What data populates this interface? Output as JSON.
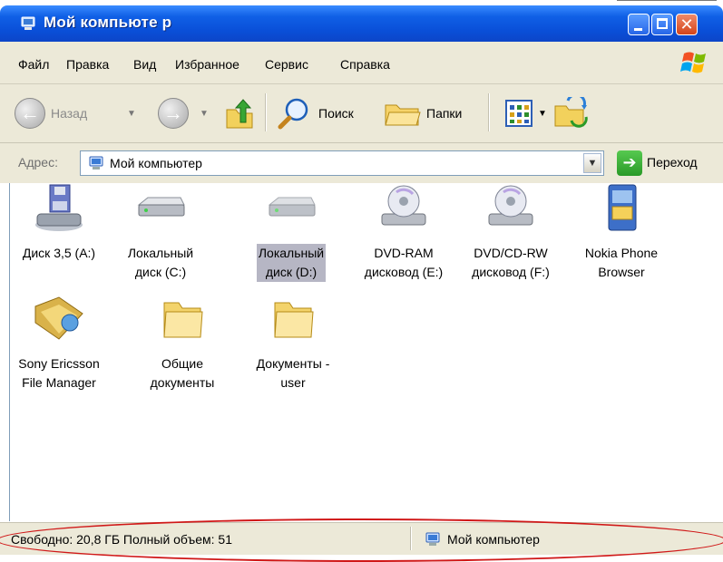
{
  "window": {
    "title": "Мой компьюте р",
    "title_icon": "my-computer-icon",
    "buttons": [
      "minimize",
      "maximize",
      "close"
    ],
    "colors": {
      "titlebar": "#0a4fd8",
      "chrome": "#ece9d8",
      "close": "#d4441a"
    }
  },
  "menu": {
    "items": [
      {
        "label": "Файл"
      },
      {
        "label": "Правка"
      },
      {
        "label": "Вид"
      },
      {
        "label": "Избранное"
      },
      {
        "label": "Сервис"
      },
      {
        "label": "Справка"
      }
    ]
  },
  "toolbar": {
    "back_label": "Назад",
    "search_label": "Поиск",
    "folders_label": "Папки"
  },
  "address": {
    "label": "Адрес:",
    "value": "Мой компьютер",
    "go_label": "Переход"
  },
  "items": [
    {
      "label_line1": "Диск 3,5 (A:)",
      "label_line2": "",
      "icon": "floppy-drive-icon",
      "selected": false
    },
    {
      "label_line1": "Локальный",
      "label_line2": "диск (C:)",
      "icon": "hard-drive-icon",
      "selected": false
    },
    {
      "label_line1": "Локальный",
      "label_line2": "диск (D:)",
      "icon": "hard-drive-icon",
      "selected": true
    },
    {
      "label_line1": "DVD-RAM",
      "label_line2": "дисковод (E:)",
      "icon": "dvd-drive-icon",
      "selected": false
    },
    {
      "label_line1": "DVD/CD-RW",
      "label_line2": "дисковод (F:)",
      "icon": "dvd-drive-icon",
      "selected": false
    },
    {
      "label_line1": "Nokia Phone",
      "label_line2": "Browser",
      "icon": "nokia-browser-icon",
      "selected": false
    },
    {
      "label_line1": "Sony Ericsson",
      "label_line2": "File Manager",
      "icon": "file-manager-icon",
      "selected": false
    },
    {
      "label_line1": "Общие",
      "label_line2": "документы",
      "icon": "folder-icon",
      "selected": false
    },
    {
      "label_line1": "Документы -",
      "label_line2": "user",
      "icon": "folder-icon",
      "selected": false
    }
  ],
  "status": {
    "left": "Свободно: 20,8 ГБ Полный объем: 51",
    "right": "Мой компьютер",
    "highlight_color": "#d01818"
  }
}
